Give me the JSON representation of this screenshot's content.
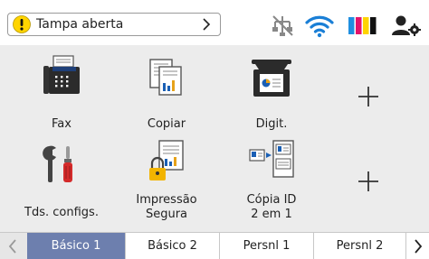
{
  "alert": {
    "text": "Tampa aberta",
    "icon": "warning-icon"
  },
  "status_icons": [
    "network-disconnected-icon",
    "wifi-icon",
    "ink-levels-icon",
    "user-settings-icon"
  ],
  "ink_colors": [
    "#1f8fe0",
    "#e3136b",
    "#ffd400",
    "#111111"
  ],
  "tiles": [
    {
      "label": "Fax",
      "icon": "fax-icon"
    },
    {
      "label": "Copiar",
      "icon": "copy-icon"
    },
    {
      "label": "Digit.",
      "icon": "scan-icon"
    },
    {
      "label": "Tds. configs.",
      "icon": "tools-icon"
    },
    {
      "label_line1": "Impressão",
      "label_line2": "Segura",
      "icon": "secure-print-icon"
    },
    {
      "label_line1": "Cópia ID",
      "label_line2": "2 em 1",
      "icon": "id-copy-icon"
    }
  ],
  "tabs": [
    "Básico 1",
    "Básico 2",
    "Persnl 1",
    "Persnl 2"
  ],
  "colors": {
    "active_tab": "#6d7fae",
    "warning": "#ffd400"
  }
}
